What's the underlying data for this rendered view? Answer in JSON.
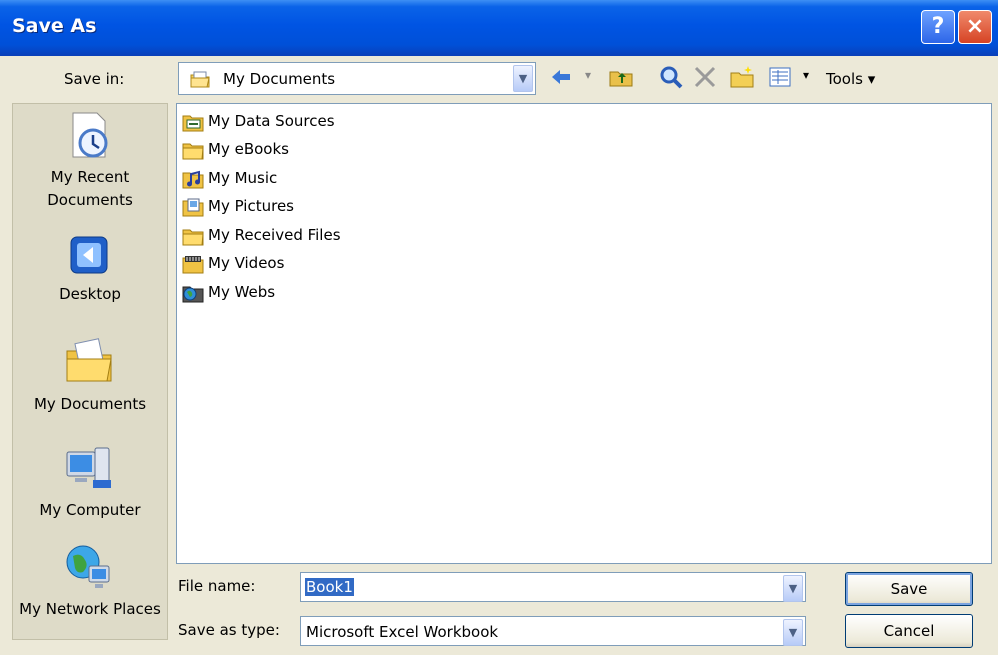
{
  "window": {
    "title": "Save As",
    "help_glyph": "?",
    "close_glyph": "×"
  },
  "toolbar": {
    "save_in_label": "Save in:",
    "save_in_value": "My Documents",
    "tools_label": "Tools",
    "icons": [
      "back-icon",
      "up-folder-icon",
      "search-web-icon",
      "delete-icon",
      "new-folder-icon",
      "views-icon"
    ]
  },
  "places": [
    {
      "label": "My Recent Documents",
      "icon": "recent-documents-icon"
    },
    {
      "label": "Desktop",
      "icon": "desktop-icon"
    },
    {
      "label": "My Documents",
      "icon": "my-documents-icon"
    },
    {
      "label": "My Computer",
      "icon": "my-computer-icon"
    },
    {
      "label": "My Network Places",
      "icon": "network-places-icon"
    }
  ],
  "files": [
    {
      "name": "My Data Sources",
      "icon": "data-sources-icon"
    },
    {
      "name": "My eBooks",
      "icon": "folder-icon"
    },
    {
      "name": "My Music",
      "icon": "music-folder-icon"
    },
    {
      "name": "My Pictures",
      "icon": "pictures-folder-icon"
    },
    {
      "name": "My Received Files",
      "icon": "folder-icon"
    },
    {
      "name": "My Videos",
      "icon": "videos-folder-icon"
    },
    {
      "name": "My Webs",
      "icon": "webs-folder-icon"
    }
  ],
  "form": {
    "file_name_label": "File name:",
    "file_name_value": "Book1",
    "save_as_type_label": "Save as type:",
    "save_as_type_value": "Microsoft Excel Workbook"
  },
  "buttons": {
    "save": "Save",
    "cancel": "Cancel"
  },
  "colors": {
    "title_bar": "#0054e3",
    "dialog_bg": "#ece9d8",
    "selection": "#316ac5"
  }
}
